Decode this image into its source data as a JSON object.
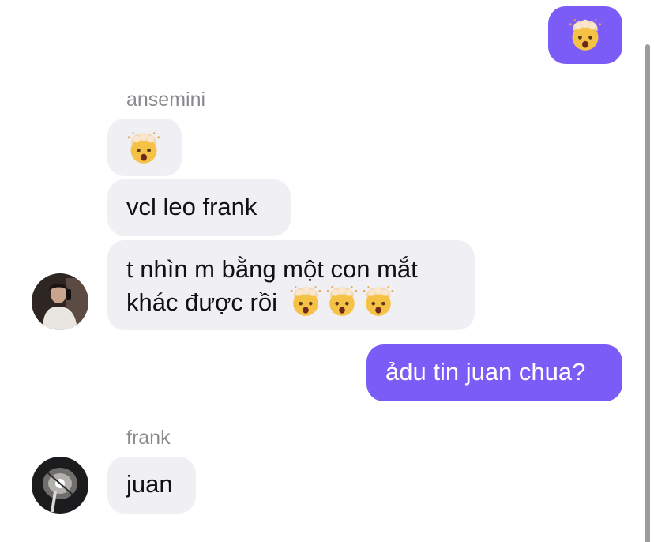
{
  "conversation": {
    "out_emoji_msg": {
      "emoji": "exploding-head"
    },
    "sender1": "ansemini",
    "msg_a1": {
      "emoji": "exploding-head"
    },
    "msg_a2": "vcl leo frank",
    "msg_a3_line1": "t nhìn m bằng một con mắt",
    "msg_a3_line2": "khác được rồi",
    "msg_a3_emojis": [
      "exploding-head",
      "exploding-head",
      "exploding-head"
    ],
    "out_text_msg": "ảdu tin juan chua?",
    "sender2": "frank",
    "msg_b1": "juan"
  },
  "colors": {
    "outgoing_bubble": "#7b5cf6",
    "incoming_bubble": "#efeff4",
    "sender_name": "#8a8a8e"
  }
}
